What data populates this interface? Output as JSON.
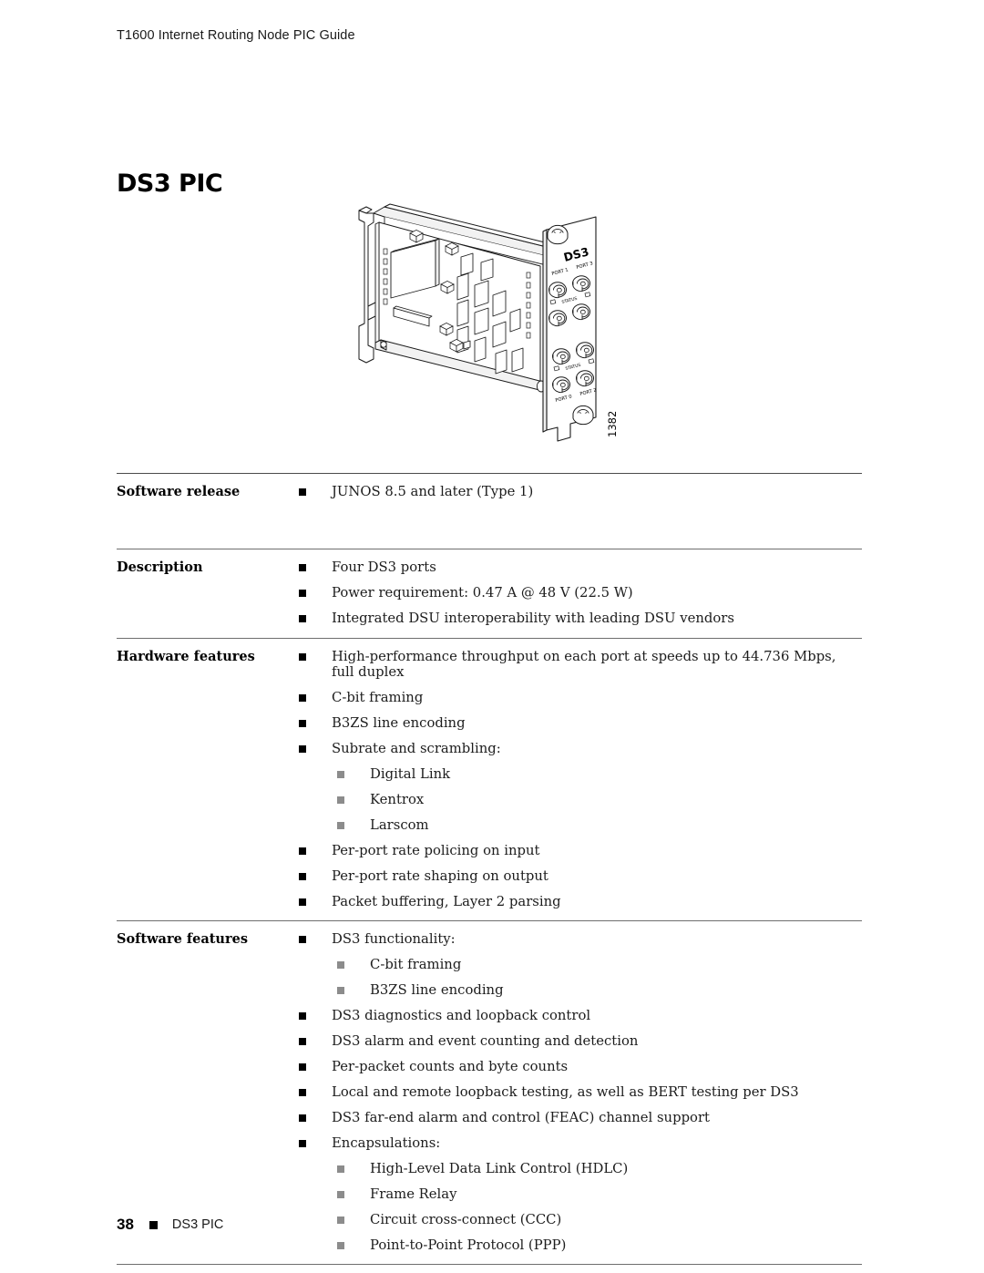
{
  "header": {
    "running_title": "T1600 Internet Routing Node PIC Guide"
  },
  "title": "DS3 PIC",
  "figure": {
    "faceplate_label": "DS3",
    "figure_number": "1382",
    "port_labels": [
      "PORT 1",
      "PORT 3",
      "PORT 0",
      "PORT 2"
    ],
    "status_labels": [
      "STATUS",
      "STATUS"
    ]
  },
  "spec_table": {
    "rows": [
      {
        "label": "Software release",
        "items": [
          {
            "text": "JUNOS 8.5 and later (Type 1)",
            "sub": []
          }
        ]
      },
      {
        "label": "Description",
        "items": [
          {
            "text": "Four DS3 ports",
            "sub": []
          },
          {
            "text": "Power requirement: 0.47 A @ 48 V (22.5 W)",
            "sub": []
          },
          {
            "text": "Integrated DSU interoperability with leading DSU vendors",
            "sub": []
          }
        ]
      },
      {
        "label": "Hardware features",
        "items": [
          {
            "text": "High-performance throughput on each port at speeds up to 44.736 Mbps, full duplex",
            "sub": []
          },
          {
            "text": "C-bit framing",
            "sub": []
          },
          {
            "text": "B3ZS line encoding",
            "sub": []
          },
          {
            "text": "Subrate and scrambling:",
            "sub": [
              "Digital Link",
              "Kentrox",
              "Larscom"
            ]
          },
          {
            "text": "Per-port rate policing on input",
            "sub": []
          },
          {
            "text": "Per-port rate shaping on output",
            "sub": []
          },
          {
            "text": "Packet buffering, Layer 2 parsing",
            "sub": []
          }
        ]
      },
      {
        "label": "Software features",
        "items": [
          {
            "text": "DS3 functionality:",
            "sub": [
              "C-bit framing",
              "B3ZS line encoding"
            ]
          },
          {
            "text": "DS3 diagnostics and loopback control",
            "sub": []
          },
          {
            "text": "DS3 alarm and event counting and detection",
            "sub": []
          },
          {
            "text": "Per-packet counts and byte counts",
            "sub": []
          },
          {
            "text": "Local and remote loopback testing, as well as BERT testing per DS3",
            "sub": []
          },
          {
            "text": "DS3 far-end alarm and control (FEAC) channel support",
            "sub": []
          },
          {
            "text": "Encapsulations:",
            "sub": [
              "High-Level Data Link Control (HDLC)",
              "Frame Relay",
              "Circuit cross-connect (CCC)",
              "Point-to-Point Protocol (PPP)"
            ]
          }
        ]
      }
    ]
  },
  "footer": {
    "page_number": "38",
    "section": "DS3 PIC"
  },
  "colors": {
    "rule": "#6e6e6e",
    "bullet": "#000000",
    "subbullet": "#8c8c8c",
    "text": "#1c1c1c"
  }
}
